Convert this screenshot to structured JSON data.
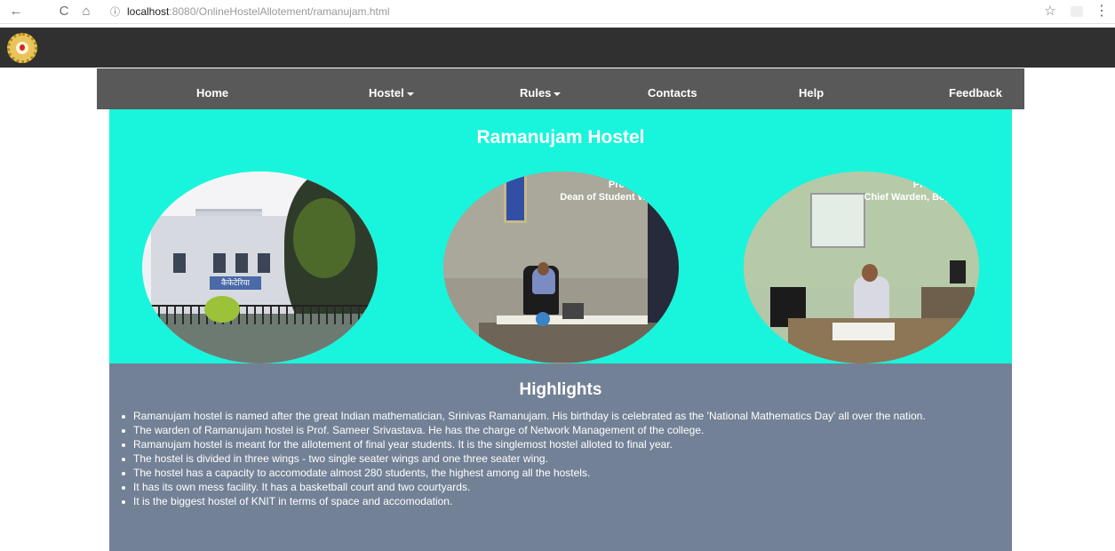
{
  "browser": {
    "back_icon": "←",
    "reload_icon": "C",
    "home_icon": "⌂",
    "info_icon": "ⓘ",
    "url_host": "localhost",
    "url_rest": ":8080/OnlineHostelAllotement/ramanujam.html",
    "star_icon": "☆",
    "menu_icon": "⋮"
  },
  "nav": {
    "items": [
      {
        "label": "Home",
        "dropdown": false
      },
      {
        "label": "Hostel",
        "dropdown": true
      },
      {
        "label": "Rules",
        "dropdown": true
      },
      {
        "label": "Contacts",
        "dropdown": false
      },
      {
        "label": "Help",
        "dropdown": false
      },
      {
        "label": "Feedback",
        "dropdown": false
      }
    ]
  },
  "hero": {
    "title": "Ramanujam Hostel",
    "photos": [
      {
        "icon": "hostel-building-photo",
        "sign_text": "कैफेटेरिया"
      },
      {
        "icon": "dean-office-photo",
        "caption_line1": "Prof. A. S",
        "caption_line2": "Dean of Student We"
      },
      {
        "icon": "chief-warden-office-photo",
        "caption_line1": "Prof. B.P.",
        "caption_line2": "Chief Warden, Boys"
      }
    ]
  },
  "highlights": {
    "title": "Highlights",
    "items": [
      "Ramanujam hostel is named after the great Indian mathematician, Srinivas Ramanujam. His birthday is celebrated as the 'National Mathematics Day' all over the nation.",
      "The warden of Ramanujam hostel is Prof. Sameer Srivastava. He has the charge of Network Management of the college.",
      "Ramanujam hostel is meant for the allotement of final year students. It is the singlemost hostel alloted to final year.",
      "The hostel is divided in three wings - two single seater wings and one three seater wing.",
      "The hostel has a capacity to accomodate almost 280 students, the highest among all the hostels.",
      "It has its own mess facility. It has a basketball court and two courtyards.",
      "It is the biggest hostel of KNIT in terms of space and accomodation."
    ]
  },
  "colors": {
    "top_bar": "#303030",
    "nav_bar": "#595959",
    "hero_bg": "#19f5dc",
    "highlights_bg": "#738196"
  }
}
